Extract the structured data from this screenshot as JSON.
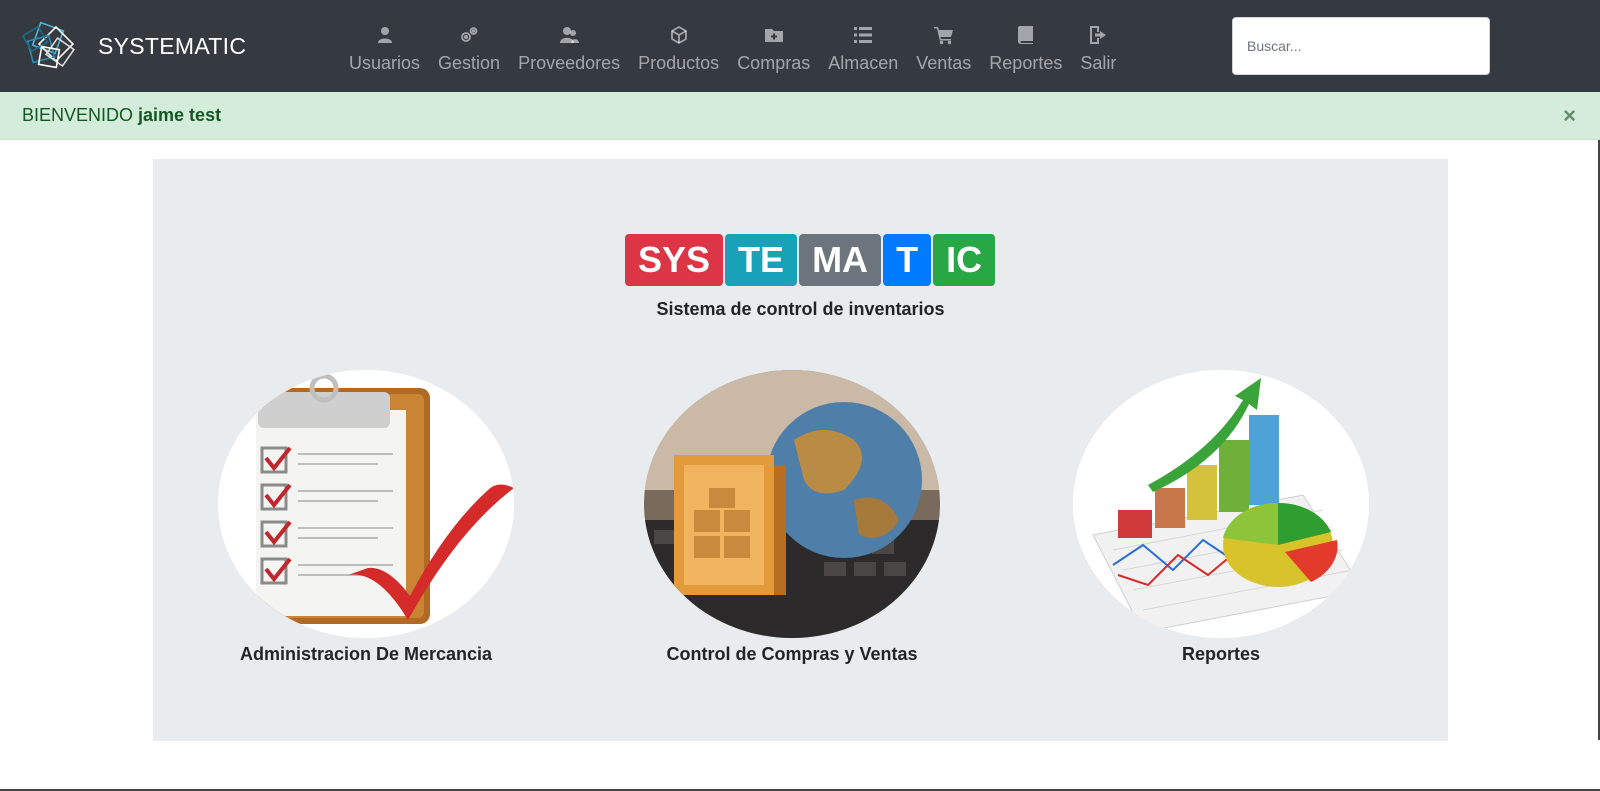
{
  "brand": {
    "name": "SYSTEMATIC",
    "logo_icon": "diamond-logo-icon"
  },
  "nav": {
    "items": [
      {
        "label": "Usuarios",
        "icon": "user-icon"
      },
      {
        "label": "Gestion",
        "icon": "gears-icon"
      },
      {
        "label": "Proveedores",
        "icon": "user-group-icon"
      },
      {
        "label": "Productos",
        "icon": "box-icon"
      },
      {
        "label": "Compras",
        "icon": "folder-plus-icon"
      },
      {
        "label": "Almacen",
        "icon": "list-icon"
      },
      {
        "label": "Ventas",
        "icon": "cart-icon"
      },
      {
        "label": "Reportes",
        "icon": "book-icon"
      },
      {
        "label": "Salir",
        "icon": "exit-door-icon"
      }
    ]
  },
  "search": {
    "placeholder": "Buscar..."
  },
  "alert": {
    "prefix": "BIENVENIDO",
    "user": "jaime test",
    "close": "×"
  },
  "logo": {
    "segments": [
      {
        "text": "SYS",
        "color": "#dc3545"
      },
      {
        "text": "TE",
        "color": "#17a2b8"
      },
      {
        "text": "MA",
        "color": "#6c757d"
      },
      {
        "text": "T",
        "color": "#007bff"
      },
      {
        "text": "IC",
        "color": "#28a745"
      }
    ],
    "subtitle": "Sistema de control de inventarios"
  },
  "cards": [
    {
      "caption": "Administracion De Mercancia"
    },
    {
      "caption": "Control de Compras y Ventas"
    },
    {
      "caption": "Reportes"
    }
  ]
}
